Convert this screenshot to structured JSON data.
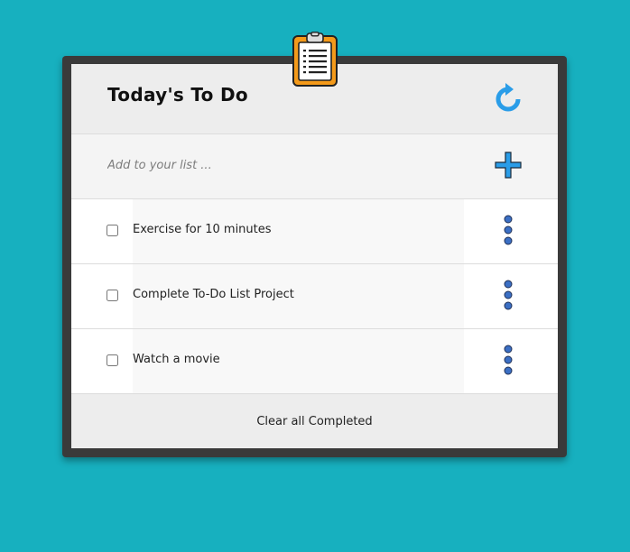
{
  "header": {
    "title": "Today's To Do",
    "refresh_icon": "refresh-icon",
    "clipboard_icon": "clipboard-icon"
  },
  "add": {
    "placeholder": "Add to your list ...",
    "value": "",
    "add_icon": "plus-icon"
  },
  "tasks": [
    {
      "label": "Exercise for 10 minutes",
      "checked": false
    },
    {
      "label": "Complete To-Do List Project",
      "checked": false
    },
    {
      "label": "Watch a movie",
      "checked": false
    }
  ],
  "footer": {
    "clear_label": "Clear all Completed"
  },
  "colors": {
    "background": "#17b0bf",
    "accent_blue": "#2a9de8",
    "frame": "#3a3a3a",
    "clipboard": "#f49a1a"
  }
}
